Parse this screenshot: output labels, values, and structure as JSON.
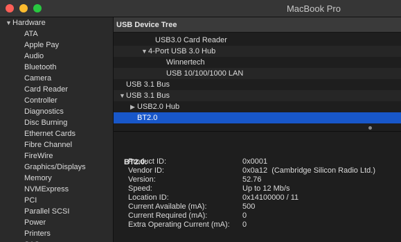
{
  "window": {
    "title": "MacBook Pro"
  },
  "sidebar": {
    "section_label": "Hardware",
    "items": [
      "ATA",
      "Apple Pay",
      "Audio",
      "Bluetooth",
      "Camera",
      "Card Reader",
      "Controller",
      "Diagnostics",
      "Disc Burning",
      "Ethernet Cards",
      "Fibre Channel",
      "FireWire",
      "Graphics/Displays",
      "Memory",
      "NVMExpress",
      "PCI",
      "Parallel SCSI",
      "Power",
      "Printers",
      "SAS"
    ]
  },
  "tree": {
    "header": "USB Device Tree",
    "rows": [
      {
        "label": "USB3.0 Card Reader",
        "indent": 3,
        "expander": ""
      },
      {
        "label": "4-Port USB 3.0 Hub",
        "indent": 2,
        "expander": "down"
      },
      {
        "label": "Winnertech",
        "indent": 4,
        "expander": ""
      },
      {
        "label": "USB 10/100/1000 LAN",
        "indent": 4,
        "expander": ""
      },
      {
        "label": "USB 3.1 Bus",
        "indent": 0,
        "expander": ""
      },
      {
        "label": "USB 3.1 Bus",
        "indent": 0,
        "expander": "down"
      },
      {
        "label": "USB2.0 Hub",
        "indent": 1,
        "expander": "right"
      },
      {
        "label": "BT2.0",
        "indent": 1,
        "expander": "",
        "selected": true
      }
    ]
  },
  "detail": {
    "title": "BT2.0:",
    "properties": [
      {
        "key": "Product ID:",
        "value": "0x0001"
      },
      {
        "key": "Vendor ID:",
        "value": "0x0a12  (Cambridge Silicon Radio Ltd.)"
      },
      {
        "key": "Version:",
        "value": "52.76"
      },
      {
        "key": "Speed:",
        "value": "Up to 12 Mb/s"
      },
      {
        "key": "Location ID:",
        "value": "0x14100000 / 11"
      },
      {
        "key": "Current Available (mA):",
        "value": "500"
      },
      {
        "key": "Current Required (mA):",
        "value": "0"
      },
      {
        "key": "Extra Operating Current (mA):",
        "value": "0"
      }
    ]
  }
}
